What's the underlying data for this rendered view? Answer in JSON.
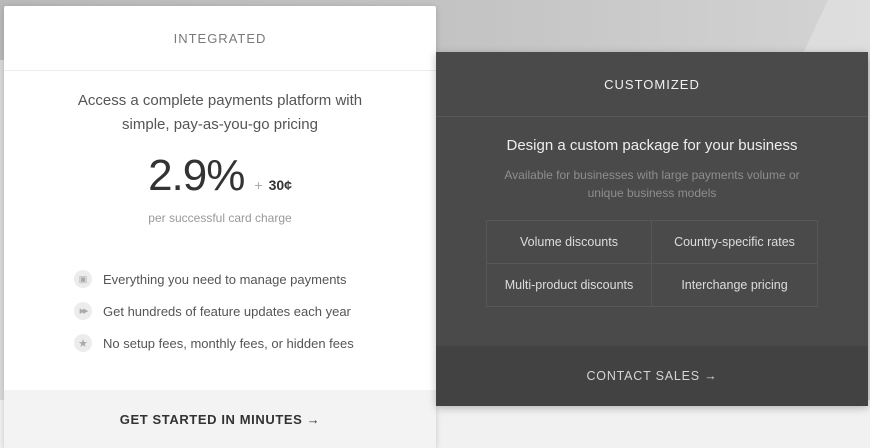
{
  "integrated": {
    "header": "INTEGRATED",
    "description": "Access a complete payments platform with simple, pay-as-you-go pricing",
    "price_main": "2.9%",
    "price_plus": "+",
    "price_cents": "30¢",
    "price_note": "per successful card charge",
    "features": [
      {
        "icon": "wallet-icon",
        "glyph": "▣",
        "text": "Everything you need to manage payments"
      },
      {
        "icon": "fast-forward-icon",
        "glyph": "▶▶",
        "text": "Get hundreds of feature updates each year"
      },
      {
        "icon": "star-icon",
        "glyph": "★",
        "text": "No setup fees, monthly fees, or hidden fees"
      }
    ],
    "cta": "GET STARTED IN MINUTES →"
  },
  "customized": {
    "header": "CUSTOMIZED",
    "title": "Design a custom package for your business",
    "description": "Available for businesses with large payments volume or unique business models",
    "options": [
      "Volume discounts",
      "Country-specific rates",
      "Multi-product discounts",
      "Interchange pricing"
    ],
    "cta": "CONTACT SALES →"
  }
}
